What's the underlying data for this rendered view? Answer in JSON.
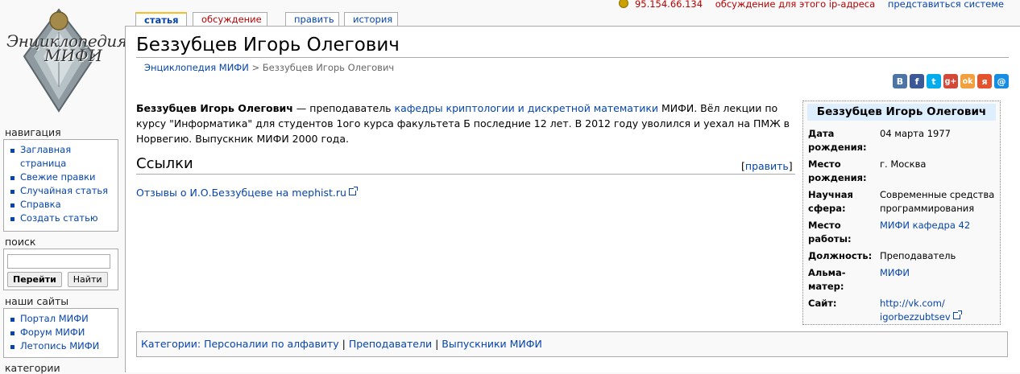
{
  "logo": {
    "text": "Энциклопедия МИФИ"
  },
  "personal": {
    "ip": "95.154.66.134",
    "ip_talk": "обсуждение для этого ip-адреса",
    "login": "представиться системе"
  },
  "tabs": [
    {
      "label": "статья"
    },
    {
      "label": "обсуждение"
    },
    {
      "label": "править"
    },
    {
      "label": "история"
    }
  ],
  "sidebar": {
    "nav_title": "навигация",
    "nav_items": [
      {
        "label": "Заглавная страница"
      },
      {
        "label": "Свежие правки"
      },
      {
        "label": "Случайная статья"
      },
      {
        "label": "Справка"
      },
      {
        "label": "Создать статью"
      }
    ],
    "search_title": "поиск",
    "search_value": "",
    "go_label": "Перейти",
    "find_label": "Найти",
    "sites_title": "наши сайты",
    "sites_items": [
      {
        "label": "Портал МИФИ"
      },
      {
        "label": "Форум МИФИ"
      },
      {
        "label": "Летопись МИФИ"
      }
    ],
    "categories_title": "категории"
  },
  "page": {
    "title": "Беззубцев Игорь Олегович",
    "breadcrumb_root": "Энциклопедия МИФИ",
    "breadcrumb_sep": " > ",
    "breadcrumb_current": "Беззубцев Игорь Олегович",
    "share": [
      {
        "icon": "vk-icon",
        "glyph": "B",
        "color": "#4d75a3"
      },
      {
        "icon": "facebook-icon",
        "glyph": "f",
        "color": "#3b5998"
      },
      {
        "icon": "twitter-icon",
        "glyph": "t",
        "color": "#00aced"
      },
      {
        "icon": "googleplus-icon",
        "glyph": "g+",
        "color": "#d34836"
      },
      {
        "icon": "odnoklassniki-icon",
        "glyph": "ok",
        "color": "#f2a03d"
      },
      {
        "icon": "moikrug-icon",
        "glyph": "я",
        "color": "#e5532e"
      },
      {
        "icon": "mailru-icon",
        "glyph": "@",
        "color": "#168de2"
      }
    ],
    "intro_bold": "Беззубцев Игорь Олегович",
    "intro_1": " — преподаватель ",
    "intro_link": "кафедры криптологии и дискретной математики",
    "intro_2": " МИФИ. Вёл лекции по курсу \"Информатика\" для студентов 1ого курса факультета Б последние 12 лет. В 2012 году уволился и уехал на ПМЖ в Норвегию. Выпускник МИФИ 2000 года.",
    "links_heading": "Ссылки",
    "edit_open": "[",
    "edit_label": "править",
    "edit_close": "]",
    "ext_link": "Отзывы о И.О.Беззубцеве на mephist.ru"
  },
  "infobox": {
    "title": "Беззубцев Игорь Олегович",
    "rows": [
      {
        "key": "Дата рождения:",
        "value": "04 марта 1977",
        "link": false
      },
      {
        "key": "Место рождения:",
        "value": "г. Москва",
        "link": false
      },
      {
        "key": "Научная сфера:",
        "value": "Современные средства программирования",
        "link": false
      },
      {
        "key": "Место работы:",
        "value": "МИФИ кафедра 42",
        "link": true
      },
      {
        "key": "Должность:",
        "value": "Преподаватель",
        "link": false
      },
      {
        "key": "Альма-матер:",
        "value": "МИФИ",
        "link": true
      },
      {
        "key": "Сайт:",
        "value": "http://vk.com/ igorbezzubtsev",
        "link": true
      }
    ]
  },
  "categories": {
    "label": "Категории",
    "colon": ": ",
    "items": [
      {
        "label": "Персоналии по алфавиту"
      },
      {
        "label": "Преподаватели"
      },
      {
        "label": "Выпускники МИФИ"
      }
    ],
    "sep": " | "
  }
}
